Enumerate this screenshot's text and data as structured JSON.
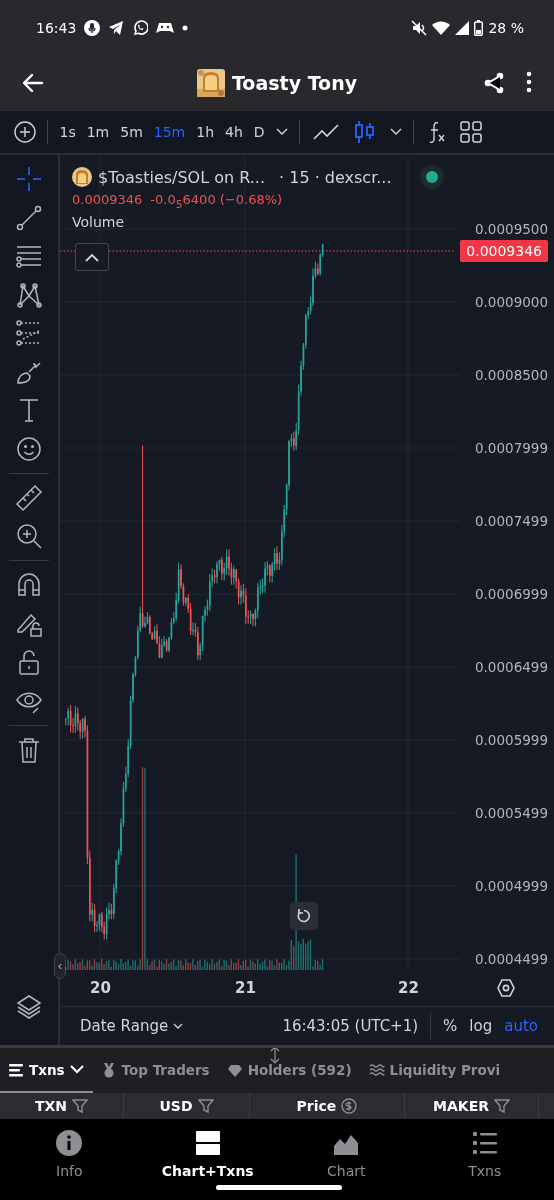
{
  "status_bar": {
    "time": "16:43",
    "battery": "28 %"
  },
  "header": {
    "title": "Toasty Tony"
  },
  "toolbar": {
    "intervals": [
      {
        "label": "1s",
        "selected": false
      },
      {
        "label": "1m",
        "selected": false
      },
      {
        "label": "5m",
        "selected": false
      },
      {
        "label": "15m",
        "selected": true
      },
      {
        "label": "1h",
        "selected": false
      },
      {
        "label": "4h",
        "selected": false
      },
      {
        "label": "D",
        "selected": false
      }
    ],
    "chart_types": [
      {
        "kind": "line",
        "selected": false
      },
      {
        "kind": "candles",
        "selected": true
      }
    ]
  },
  "drawing_tools": [
    [
      {
        "kind": "crosshair",
        "selected": true
      },
      {
        "kind": "trend-line",
        "selected": false
      },
      {
        "kind": "fib",
        "selected": false
      },
      {
        "kind": "pattern",
        "selected": false
      },
      {
        "kind": "projection",
        "selected": false
      },
      {
        "kind": "brush",
        "selected": false
      },
      {
        "kind": "text",
        "selected": false
      },
      {
        "kind": "emoji",
        "selected": false
      }
    ],
    [
      {
        "kind": "ruler",
        "selected": false
      },
      {
        "kind": "zoom",
        "selected": false
      }
    ],
    [
      {
        "kind": "magnet",
        "selected": false
      },
      {
        "kind": "lock-drawing",
        "selected": false
      },
      {
        "kind": "lock",
        "selected": false
      },
      {
        "kind": "eye",
        "selected": false
      }
    ],
    [
      {
        "kind": "trash",
        "selected": false
      }
    ]
  ],
  "legend": {
    "symbol": "$Toasties/SOL on R...",
    "meta": "· 15 · dexscr...",
    "price": "0.0009346",
    "change": "-0.0$_{5}$6400 (−0.68%)",
    "volume_label": "Volume"
  },
  "price_axis": [
    "0.0009500",
    "0.0009000",
    "0.0008500",
    "0.0007999",
    "0.0007499",
    "0.0006999",
    "0.0006499",
    "0.0005999",
    "0.0005499",
    "0.0004999",
    "0.0004499"
  ],
  "last_price": "0.0009346",
  "time_axis": [
    "20",
    "21",
    "22"
  ],
  "collapse_handle": "‹",
  "footer": {
    "date_range": "Date Range",
    "time": "16:43:05 (UTC+1)",
    "options": [
      {
        "label": "%",
        "selected": false
      },
      {
        "label": "log",
        "selected": false
      },
      {
        "label": "auto",
        "selected": true
      }
    ]
  },
  "tabs": [
    {
      "label": "Txns",
      "kind": "list",
      "selected": true
    },
    {
      "label": "Top Traders",
      "kind": "medal",
      "selected": false
    },
    {
      "label": "Holders (592)",
      "kind": "diamond",
      "selected": false
    },
    {
      "label": "Liquidity Provi",
      "kind": "waves",
      "selected": false
    }
  ],
  "columns": [
    {
      "label": "TXN",
      "kind": "filter"
    },
    {
      "label": "USD",
      "kind": "filter"
    },
    {
      "label": "Price",
      "kind": "dollar"
    },
    {
      "label": "MAKER",
      "kind": "filter"
    }
  ],
  "nav": [
    {
      "label": "Info",
      "kind": "info",
      "selected": false
    },
    {
      "label": "Chart+Txns",
      "kind": "split",
      "selected": true
    },
    {
      "label": "Chart",
      "kind": "chart",
      "selected": false
    },
    {
      "label": "Txns",
      "kind": "list",
      "selected": false
    }
  ]
}
